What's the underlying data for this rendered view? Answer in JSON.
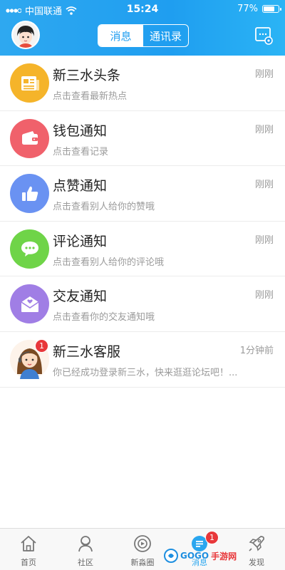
{
  "status_bar": {
    "carrier": "中国联通",
    "time": "15:24",
    "battery": "77%"
  },
  "header": {
    "tabs": [
      {
        "label": "消息",
        "active": true
      },
      {
        "label": "通讯录",
        "active": false
      }
    ]
  },
  "messages": [
    {
      "title": "新三水头条",
      "subtitle": "点击查看最新热点",
      "time": "刚刚",
      "icon": "newspaper-icon",
      "color": "#f5b42a"
    },
    {
      "title": "钱包通知",
      "subtitle": "点击查看记录",
      "time": "刚刚",
      "icon": "wallet-icon",
      "color": "#f0616b"
    },
    {
      "title": "点赞通知",
      "subtitle": "点击查看别人给你的赞哦",
      "time": "刚刚",
      "icon": "thumbs-up-icon",
      "color": "#6a92f2"
    },
    {
      "title": "评论通知",
      "subtitle": "点击查看别人给你的评论哦",
      "time": "刚刚",
      "icon": "comment-icon",
      "color": "#6fd448"
    },
    {
      "title": "交友通知",
      "subtitle": "点击查看你的交友通知哦",
      "time": "刚刚",
      "icon": "mail-icon",
      "color": "#a07ee5"
    },
    {
      "title": "新三水客服",
      "subtitle": "你已经成功登录新三水，快来逛逛论坛吧！...",
      "time": "1分钟前",
      "icon": "service-avatar-icon",
      "badge": "1"
    }
  ],
  "tabbar": {
    "items": [
      {
        "label": "首页",
        "icon": "home-icon"
      },
      {
        "label": "社区",
        "icon": "community-icon"
      },
      {
        "label": "新淼圈",
        "icon": "circle-icon"
      },
      {
        "label": "消息",
        "icon": "message-icon",
        "active": true,
        "badge": "1"
      },
      {
        "label": "发现",
        "icon": "rocket-icon"
      }
    ]
  },
  "watermark": {
    "brand": "GOGO",
    "suffix": "手游网"
  },
  "colors": {
    "accent": "#1f9ef0",
    "badge": "#e8373a"
  }
}
